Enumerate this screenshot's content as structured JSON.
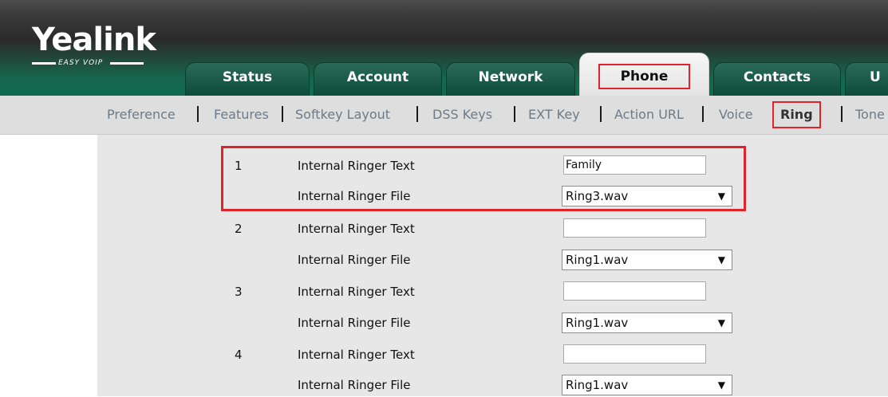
{
  "brand": {
    "name": "Yealink",
    "tagline": "EASY VOIP"
  },
  "tabs": [
    {
      "label": "Status",
      "active": false
    },
    {
      "label": "Account",
      "active": false
    },
    {
      "label": "Network",
      "active": false
    },
    {
      "label": "Phone",
      "active": true
    },
    {
      "label": "Contacts",
      "active": false
    },
    {
      "label": "U",
      "active": false
    }
  ],
  "subnav": [
    {
      "label": "Preference",
      "active": false
    },
    {
      "label": "Features",
      "active": false
    },
    {
      "label": "Softkey Layout",
      "active": false
    },
    {
      "label": "DSS Keys",
      "active": false
    },
    {
      "label": "EXT Key",
      "active": false
    },
    {
      "label": "Action URL",
      "active": false
    },
    {
      "label": "Voice",
      "active": false
    },
    {
      "label": "Ring",
      "active": true
    },
    {
      "label": "Tone",
      "active": false
    }
  ],
  "ringers": [
    {
      "number": "1",
      "text_label": "Internal Ringer Text",
      "text_value": "Family",
      "file_label": "Internal Ringer File",
      "file_value": "Ring3.wav"
    },
    {
      "number": "2",
      "text_label": "Internal Ringer Text",
      "text_value": "",
      "file_label": "Internal Ringer File",
      "file_value": "Ring1.wav"
    },
    {
      "number": "3",
      "text_label": "Internal Ringer Text",
      "text_value": "",
      "file_label": "Internal Ringer File",
      "file_value": "Ring1.wav"
    },
    {
      "number": "4",
      "text_label": "Internal Ringer Text",
      "text_value": "",
      "file_label": "Internal Ringer File",
      "file_value": "Ring1.wav"
    }
  ],
  "colors": {
    "highlight": "#e0242a",
    "header_green": "#0f6a50",
    "content_bg": "#e7e7e7"
  }
}
